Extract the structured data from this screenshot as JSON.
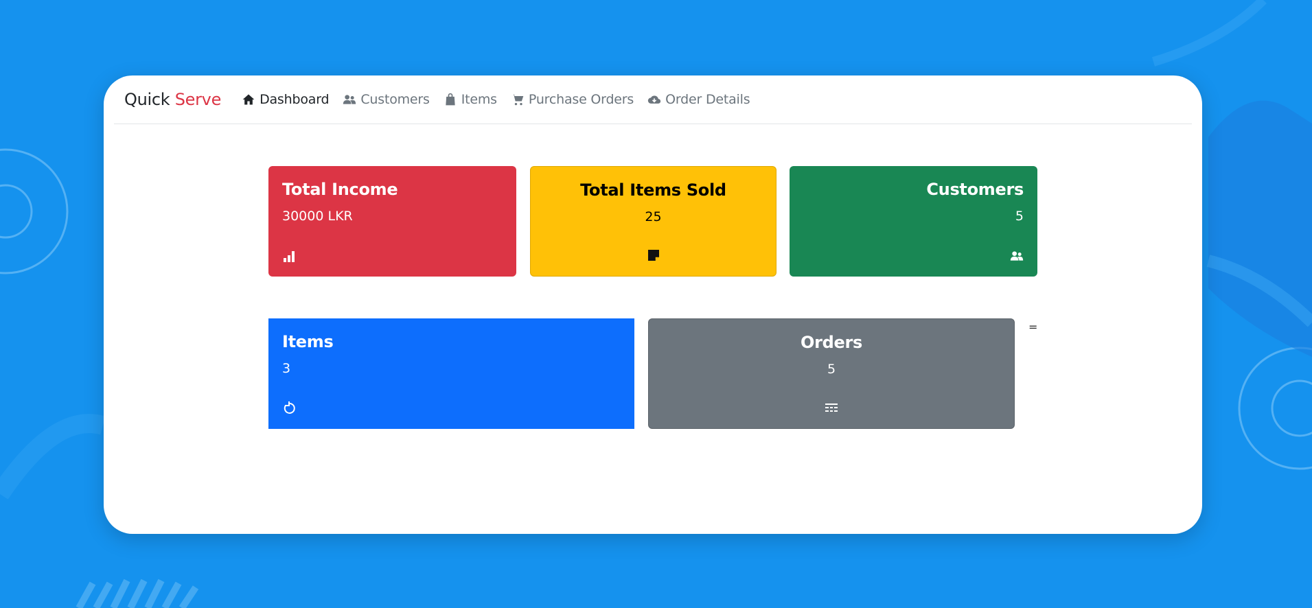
{
  "brand": {
    "name": "Quick",
    "accent": "Serve"
  },
  "nav": [
    {
      "label": "Dashboard",
      "icon": "house-icon",
      "active": true
    },
    {
      "label": "Customers",
      "icon": "users-icon"
    },
    {
      "label": "Items",
      "icon": "shopping-bag-icon"
    },
    {
      "label": "Purchase Orders",
      "icon": "cart-icon"
    },
    {
      "label": "Order Details",
      "icon": "cloud-download-icon"
    }
  ],
  "stats": {
    "income": {
      "title": "Total Income",
      "value": "30000 LKR",
      "icon": "bar-chart-icon",
      "color": "#dc3545"
    },
    "sold": {
      "title": "Total Items Sold",
      "value": "25",
      "icon": "sticky-note-icon",
      "color": "#ffc107"
    },
    "customers": {
      "title": "Customers",
      "value": "5",
      "icon": "users-icon",
      "color": "#198754"
    },
    "items": {
      "title": "Items",
      "value": "3",
      "icon": "refresh-icon",
      "color": "#0d6efd"
    },
    "orders": {
      "title": "Orders",
      "value": "5",
      "icon": "list-icon",
      "color": "#6c757d"
    }
  },
  "stray_text": "="
}
